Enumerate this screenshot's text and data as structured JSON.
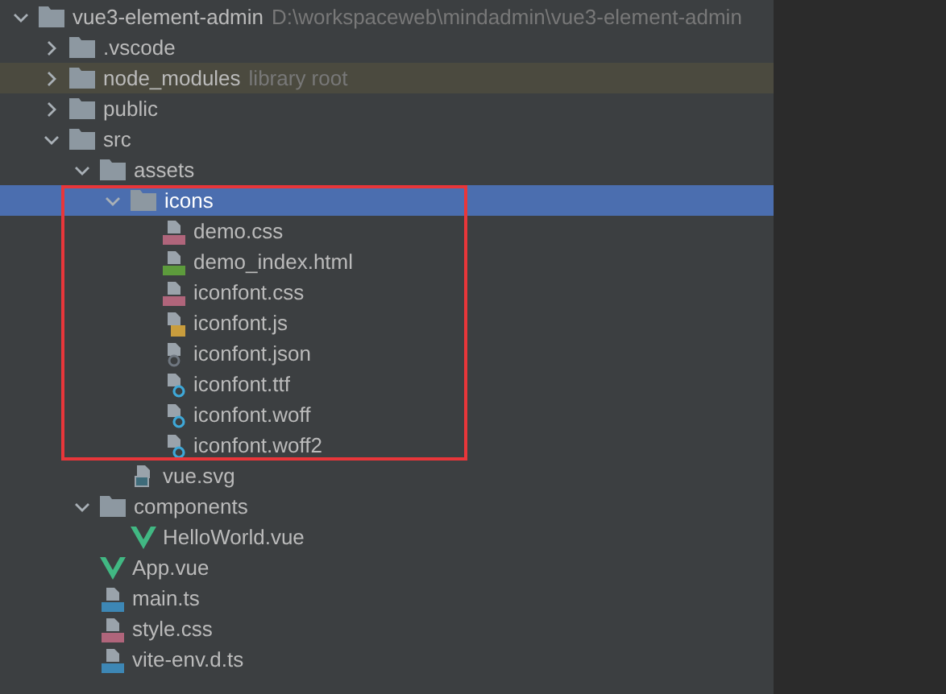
{
  "tree": [
    {
      "kind": "folder",
      "name": "vue3-element-admin",
      "hint": "D:\\workspaceweb\\mindadmin\\vue3-element-admin",
      "expanded": true,
      "selected": false,
      "children": [
        {
          "kind": "folder",
          "name": ".vscode",
          "expanded": false,
          "selected": false
        },
        {
          "kind": "folder",
          "name": "node_modules",
          "hint": "library root",
          "library": true,
          "expanded": false,
          "selected": false
        },
        {
          "kind": "folder",
          "name": "public",
          "expanded": false,
          "selected": false
        },
        {
          "kind": "folder",
          "name": "src",
          "expanded": true,
          "selected": false,
          "children": [
            {
              "kind": "folder",
              "name": "assets",
              "expanded": true,
              "selected": false,
              "children": [
                {
                  "kind": "folder",
                  "name": "icons",
                  "expanded": true,
                  "selected": true,
                  "highlighted": true,
                  "children": [
                    {
                      "kind": "css",
                      "name": "demo.css",
                      "selected": false
                    },
                    {
                      "kind": "html",
                      "name": "demo_index.html",
                      "selected": false
                    },
                    {
                      "kind": "css",
                      "name": "iconfont.css",
                      "selected": false
                    },
                    {
                      "kind": "js",
                      "name": "iconfont.js",
                      "selected": false
                    },
                    {
                      "kind": "json",
                      "name": "iconfont.json",
                      "selected": false
                    },
                    {
                      "kind": "unknown",
                      "name": "iconfont.ttf",
                      "selected": false
                    },
                    {
                      "kind": "unknown",
                      "name": "iconfont.woff",
                      "selected": false
                    },
                    {
                      "kind": "unknown",
                      "name": "iconfont.woff2",
                      "selected": false
                    }
                  ]
                },
                {
                  "kind": "image",
                  "name": "vue.svg",
                  "selected": false
                }
              ]
            },
            {
              "kind": "folder",
              "name": "components",
              "expanded": true,
              "selected": false,
              "children": [
                {
                  "kind": "vue",
                  "name": "HelloWorld.vue",
                  "selected": false
                }
              ]
            },
            {
              "kind": "vue",
              "name": "App.vue",
              "selected": false
            },
            {
              "kind": "ts",
              "name": "main.ts",
              "selected": false
            },
            {
              "kind": "css",
              "name": "style.css",
              "selected": false
            },
            {
              "kind": "ts",
              "name": "vite-env.d.ts",
              "selected": false
            }
          ]
        }
      ]
    }
  ]
}
